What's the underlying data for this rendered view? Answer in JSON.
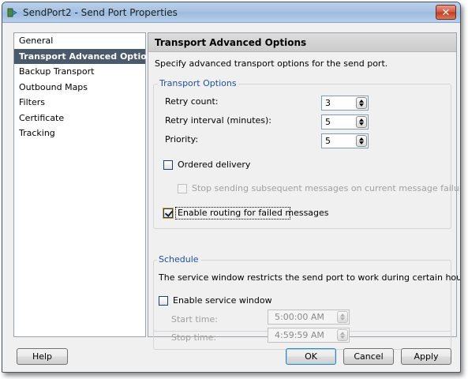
{
  "window": {
    "title": "SendPort2 - Send Port Properties",
    "close_label": "✕"
  },
  "nav": {
    "items": [
      {
        "label": "General",
        "selected": false
      },
      {
        "label": "Transport Advanced Options",
        "selected": true
      },
      {
        "label": "Backup Transport",
        "selected": false
      },
      {
        "label": "Outbound Maps",
        "selected": false
      },
      {
        "label": "Filters",
        "selected": false
      },
      {
        "label": "Certificate",
        "selected": false
      },
      {
        "label": "Tracking",
        "selected": false
      }
    ]
  },
  "panel": {
    "header": "Transport Advanced Options",
    "description": "Specify advanced transport options for the send port.",
    "transport_options": {
      "title": "Transport Options",
      "retry_count_label": "Retry count:",
      "retry_count_value": "3",
      "retry_interval_label": "Retry interval (minutes):",
      "retry_interval_value": "5",
      "priority_label": "Priority:",
      "priority_value": "5",
      "ordered_delivery_label": "Ordered delivery",
      "ordered_delivery_checked": false,
      "stop_sending_label": "Stop sending subsequent messages on current message failure",
      "stop_sending_checked": false,
      "enable_routing_label": "Enable routing for failed messages",
      "enable_routing_checked": true
    },
    "schedule": {
      "title": "Schedule",
      "description": "The service window restricts the send port to work during certain hours of the day.",
      "enable_window_label": "Enable service window",
      "enable_window_checked": false,
      "start_time_label": "Start time:",
      "start_time_value": "5:00:00 AM",
      "stop_time_label": "Stop time:",
      "stop_time_value": "4:59:59 AM"
    }
  },
  "buttons": {
    "help": "Help",
    "ok": "OK",
    "cancel": "Cancel",
    "apply": "Apply"
  },
  "colors": {
    "group_title": "#1e50a0",
    "nav_selected_bg": "#4a5a6a",
    "close_button": "#c43a1e"
  }
}
